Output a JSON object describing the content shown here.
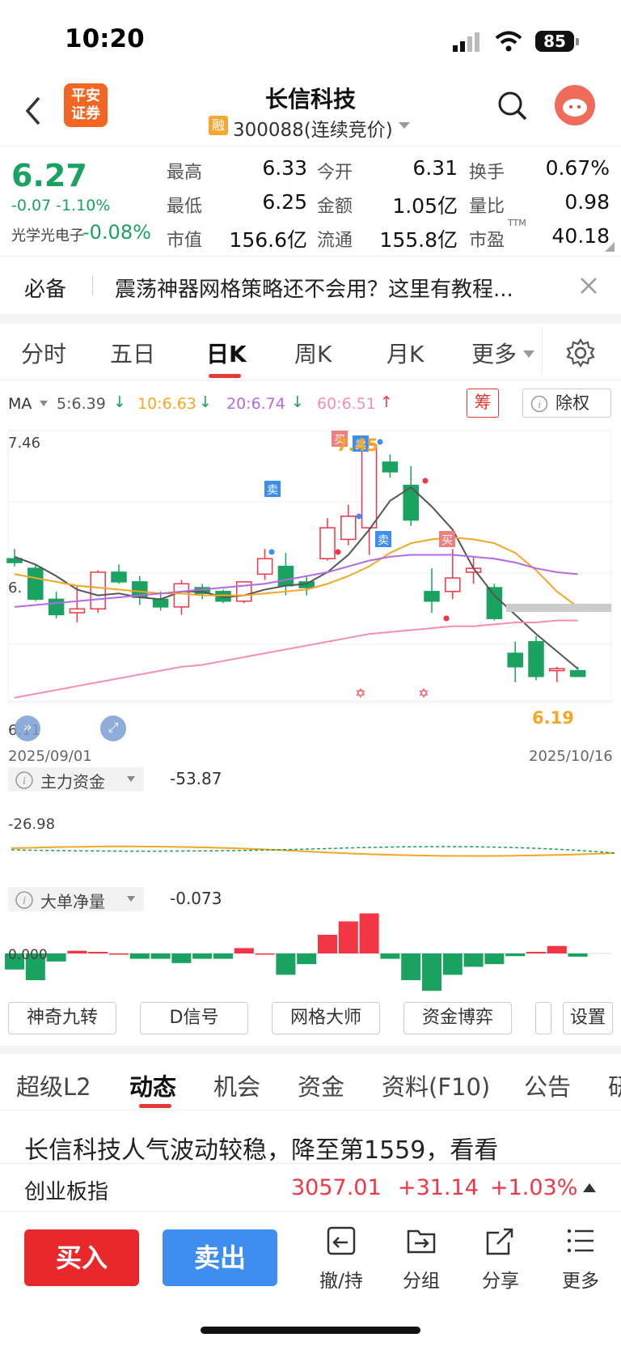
{
  "status": {
    "time": "10:20",
    "battery": "85"
  },
  "header": {
    "title": "长信科技",
    "rong_badge": "融",
    "code": "300088(连续竞价)",
    "logo_line1": "平安",
    "logo_line2": "证券"
  },
  "quote": {
    "price": "6.27",
    "change": "-0.07 -1.10%",
    "sector_name": "光学光电子",
    "sector_change": "-0.08%",
    "fields": [
      {
        "label": "最高",
        "value": "6.33"
      },
      {
        "label": "今开",
        "value": "6.31"
      },
      {
        "label": "换手",
        "value": "0.67%"
      },
      {
        "label": "最低",
        "value": "6.25"
      },
      {
        "label": "金额",
        "value": "1.05亿"
      },
      {
        "label": "量比",
        "value": "0.98"
      },
      {
        "label": "市值",
        "value": "156.6亿"
      },
      {
        "label": "流通",
        "value": "155.8亿"
      },
      {
        "label": "市盈",
        "value": "40.18"
      }
    ],
    "ttm": "TTM"
  },
  "notice": {
    "tag": "必备",
    "text": "震荡神器网格策略还不会用？这里有教程..."
  },
  "ktabs": [
    "分时",
    "五日",
    "日K",
    "周K",
    "月K",
    "更多"
  ],
  "ma": {
    "label": "MA",
    "ma5": "5:6.39",
    "ma10": "10:6.63",
    "ma20": "20:6.74",
    "ma60": "60:6.51",
    "chou": "筹",
    "chuquan": "除权"
  },
  "chart": {
    "y_top": "7.46",
    "y_mid": "6.",
    "y_bottom": "6.11",
    "high_label": "7.45",
    "low_label": "6.19",
    "date_start": "2025/09/01",
    "date_end": "2025/10/16",
    "buy": "买",
    "sell": "卖"
  },
  "colors": {
    "up": "#f23645",
    "down": "#1aa260",
    "ma5": "#555555",
    "ma10": "#f5a623",
    "ma20": "#b36bdf",
    "ma60": "#f48fb1",
    "accent": "#e53935",
    "blue": "#3d8ef0"
  },
  "fund": {
    "label": "主力资金",
    "value": "-53.87",
    "axis": "-26.98"
  },
  "bigorder": {
    "label": "大单净量",
    "value": "-0.073",
    "axis": "0.000"
  },
  "toolbar": [
    "神奇九转",
    "D信号",
    "网格大师",
    "资金博弈",
    "设置"
  ],
  "ntabs": [
    "超级L2",
    "动态",
    "机会",
    "资金",
    "资料(F10)",
    "公告",
    "研"
  ],
  "news": {
    "headline": "长信科技人气波动较稳，降至第1559，看看"
  },
  "index": {
    "name": "创业板指",
    "value": "3057.01",
    "change": "+31.14",
    "pct": "+1.03%"
  },
  "bottom": {
    "buy": "买入",
    "sell": "卖出",
    "items": [
      "撤/持",
      "分组",
      "分享",
      "更多"
    ]
  }
}
